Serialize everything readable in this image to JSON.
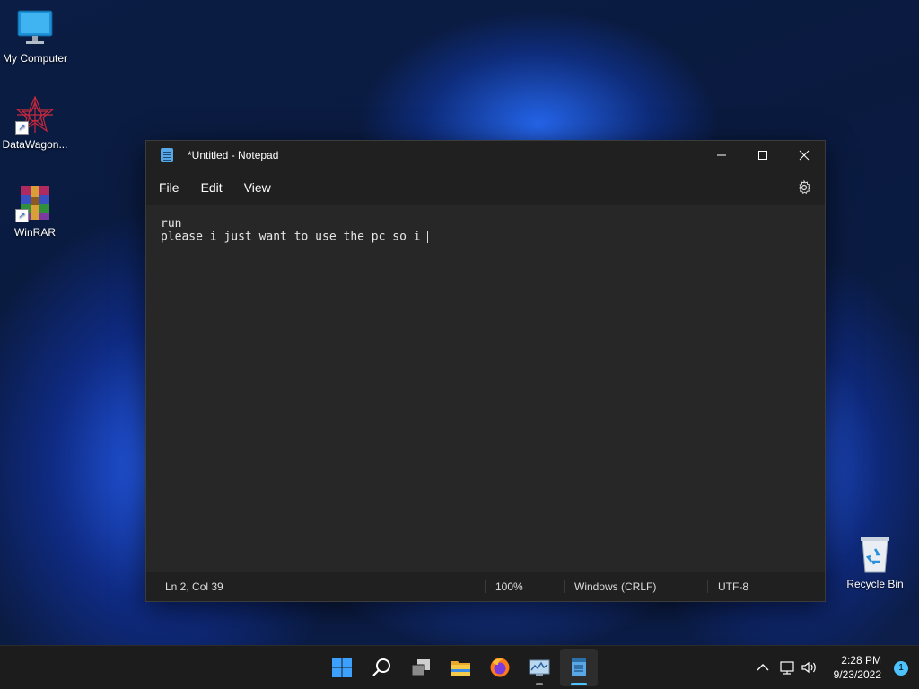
{
  "desktop": {
    "icons": [
      {
        "label": "My Computer"
      },
      {
        "label": "DataWagon..."
      },
      {
        "label": "WinRAR"
      },
      {
        "label": "Recycle Bin"
      }
    ]
  },
  "notepad": {
    "title": "*Untitled - Notepad",
    "menu": [
      "File",
      "Edit",
      "View"
    ],
    "content": [
      "run",
      "please i just want to use the pc so i "
    ],
    "status": {
      "position": "Ln 2, Col 39",
      "zoom": "100%",
      "line_ending": "Windows (CRLF)",
      "encoding": "UTF-8"
    }
  },
  "taskbar": {
    "apps": [
      "start-icon",
      "search-icon",
      "task-view-icon",
      "file-explorer-icon",
      "firefox-icon",
      "performance-monitor-icon",
      "notepad-icon"
    ],
    "clock": {
      "time": "2:28 PM",
      "date": "9/23/2022"
    },
    "notification_count": "1"
  },
  "colors": {
    "accent": "#4cc2ff",
    "window_bg": "#272727",
    "titlebar_bg": "#202020"
  }
}
